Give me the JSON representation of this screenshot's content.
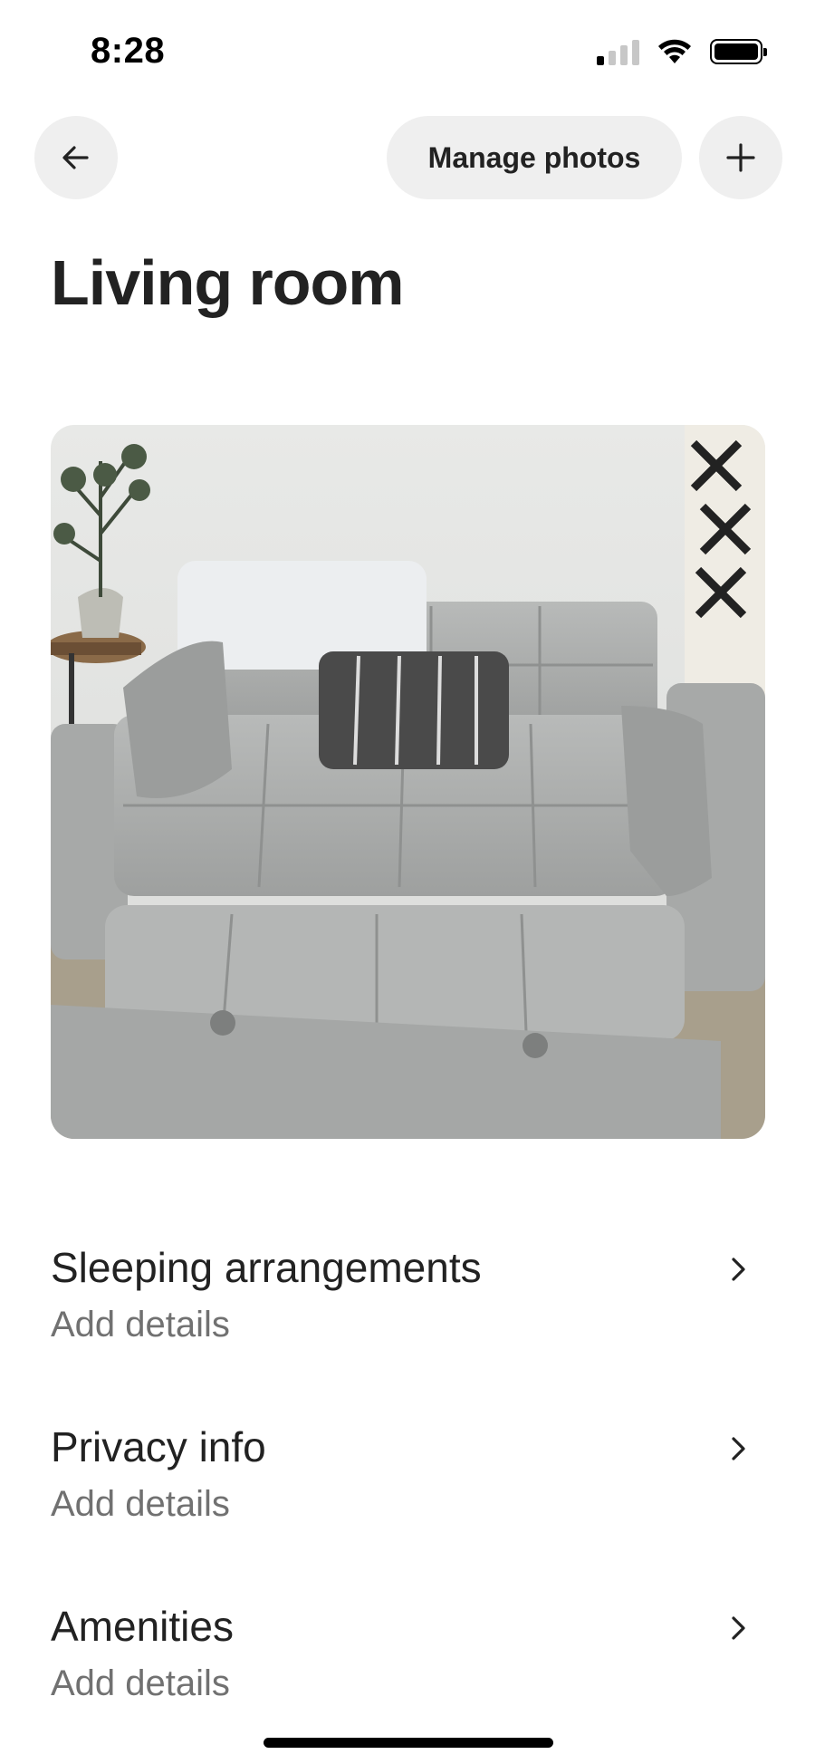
{
  "status_bar": {
    "time": "8:28",
    "signal_icon": "cellular-signal-icon",
    "wifi_icon": "wifi-icon",
    "battery_icon": "battery-icon"
  },
  "header": {
    "back_icon": "arrow-left-icon",
    "manage_photos_label": "Manage photos",
    "add_icon": "plus-icon"
  },
  "page": {
    "title": "Living room"
  },
  "photo": {
    "alt": "Gray pull-out sleeper sofa with pillows and throw blanket"
  },
  "rows": [
    {
      "title": "Sleeping arrangements",
      "subtitle": "Add details",
      "icon": "chevron-right-icon"
    },
    {
      "title": "Privacy info",
      "subtitle": "Add details",
      "icon": "chevron-right-icon"
    },
    {
      "title": "Amenities",
      "subtitle": "Add details",
      "icon": "chevron-right-icon"
    }
  ],
  "colors": {
    "button_bg": "#efefef",
    "text_primary": "#222222",
    "text_secondary": "#717171"
  }
}
